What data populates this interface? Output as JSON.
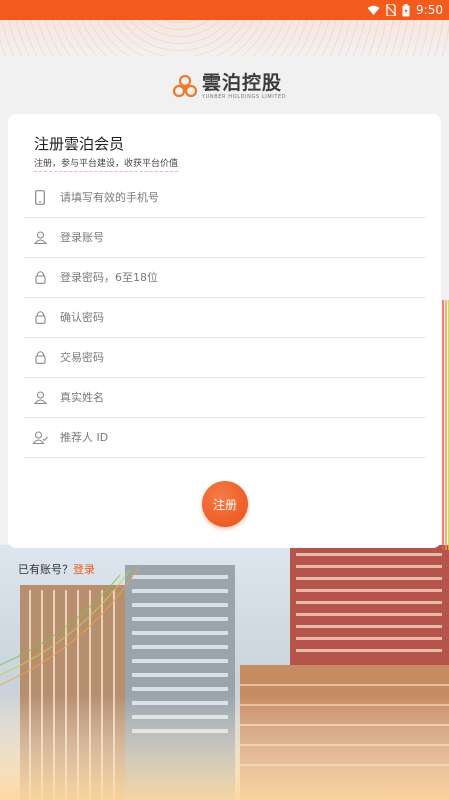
{
  "statusbar": {
    "time": "9:50"
  },
  "logo": {
    "name_cn": "雲泊控股",
    "name_en": "YUNBER HOLDINGS LIMITED"
  },
  "form": {
    "title": "注册雲泊会员",
    "subtitle": "注册，参与平台建设，收获平台价值",
    "fields": [
      {
        "placeholder": "请填写有效的手机号",
        "icon": "phone-icon"
      },
      {
        "placeholder": "登录账号",
        "icon": "user-icon"
      },
      {
        "placeholder": "登录密码，6至18位",
        "icon": "lock-icon"
      },
      {
        "placeholder": "确认密码",
        "icon": "lock-icon"
      },
      {
        "placeholder": "交易密码",
        "icon": "lock-icon"
      },
      {
        "placeholder": "真实姓名",
        "icon": "user-icon"
      },
      {
        "placeholder": "推荐人 ID",
        "icon": "user-check-icon"
      }
    ],
    "submit_label": "注册"
  },
  "footer": {
    "has_account": "已有账号？",
    "login_link": "登录"
  },
  "colors": {
    "accent": "#f25a1e",
    "card": "#ffffff",
    "background": "#f1f1f1"
  }
}
